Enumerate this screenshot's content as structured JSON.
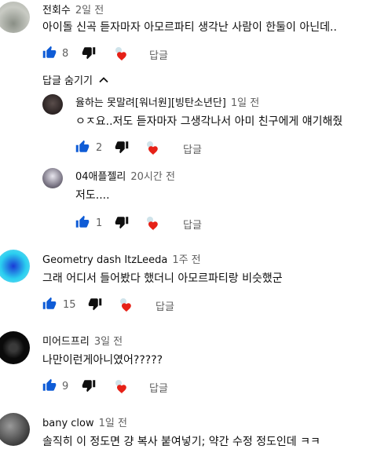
{
  "comments": [
    {
      "author": "전회수",
      "time": "2일 전",
      "text": "아이돌 신곡 듣자마자 아모르파티 생각난 사람이 한둘이 아닌데..",
      "likes": "8",
      "reply": "답글"
    },
    {
      "author": "율하는 못말려[워너원][빙탄소년단]",
      "time": "1일 전",
      "text": "ㅇㅈ요..저도 듣자마자 그생각나서 아미 친구에게 얘기해줬",
      "likes": "2",
      "reply": "답글"
    },
    {
      "author": "04애플젤리",
      "time": "20시간 전",
      "text": "저도....",
      "likes": "1",
      "reply": "답글"
    },
    {
      "author": "Geometry dash ItzLeeda",
      "time": "1주 전",
      "text": "그래 어디서 들어봤다 했더니 아모르파티랑 비슷했군",
      "likes": "15",
      "reply": "답글"
    },
    {
      "author": "미어드프리",
      "time": "3일 전",
      "text": "나만이런게아니였어?????",
      "likes": "9",
      "reply": "답글"
    },
    {
      "author": "bany clow",
      "time": "1일 전",
      "text": "솔직히 이 정도면 걍 복사 붙여넣기; 약간 수정 정도인데 ㅋㅋ",
      "likes": "",
      "reply": ""
    }
  ],
  "replies_toggle": {
    "label": "답글 숨기기"
  },
  "colors": {
    "heart": "#e62117",
    "icon": "#0f0f0f",
    "meta": "#606060"
  },
  "icons": {
    "like": "thumb-up-icon",
    "dislike": "thumb-down-icon",
    "heart": "creator-heart-icon",
    "toggle": "chevron-up-icon"
  }
}
